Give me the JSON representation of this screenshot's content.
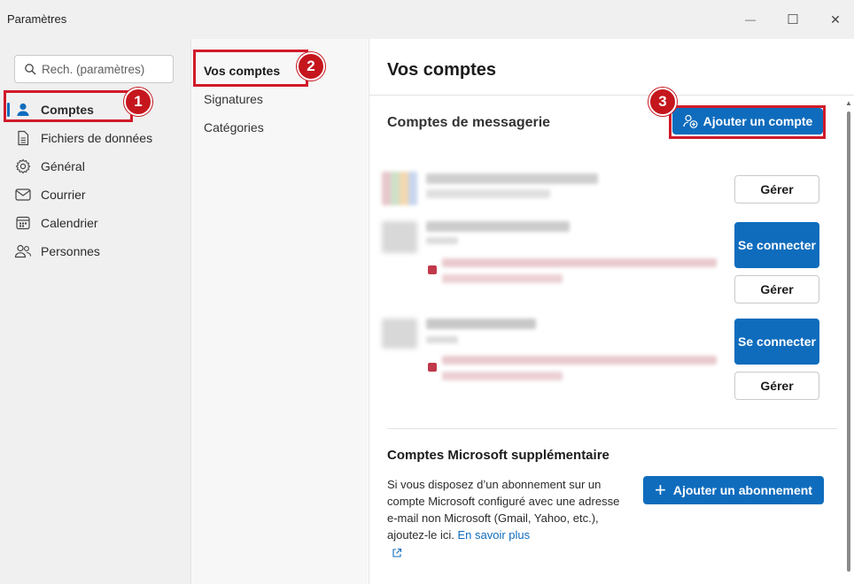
{
  "window": {
    "title": "Paramètres",
    "controls": {
      "minimize": "—",
      "maximize": "☐",
      "close": "✕"
    }
  },
  "nav": {
    "search_placeholder": "Rech. (paramètres)",
    "items": [
      {
        "label": "Comptes",
        "icon": "person-icon",
        "active": true
      },
      {
        "label": "Fichiers de données",
        "icon": "document-icon",
        "active": false
      },
      {
        "label": "Général",
        "icon": "gear-icon",
        "active": false
      },
      {
        "label": "Courrier",
        "icon": "mail-icon",
        "active": false
      },
      {
        "label": "Calendrier",
        "icon": "calendar-icon",
        "active": false
      },
      {
        "label": "Personnes",
        "icon": "people-icon",
        "active": false
      }
    ]
  },
  "subnav": {
    "items": [
      {
        "label": "Vos comptes",
        "active": true
      },
      {
        "label": "Signatures",
        "active": false
      },
      {
        "label": "Catégories",
        "active": false
      }
    ]
  },
  "main": {
    "title": "Vos comptes",
    "email_section_title": "Comptes de messagerie",
    "add_account_label": "Ajouter un compte",
    "accounts": [
      {
        "manage_label": "Gérer"
      },
      {
        "connect_label": "Se connecter",
        "manage_label": "Gérer"
      },
      {
        "connect_label": "Se connecter",
        "manage_label": "Gérer"
      }
    ],
    "ms_section_title": "Comptes Microsoft supplémentaire",
    "ms_text": "Si vous disposez d’un abonnement sur un compte Microsoft configuré avec une adresse e-mail non Microsoft (Gmail, Yahoo, etc.), ajoutez-le ici.",
    "ms_link": "En savoir plus",
    "add_subscription_label": "Ajouter un abonnement"
  },
  "callouts": [
    "1",
    "2",
    "3"
  ],
  "colors": {
    "accent": "#0f6cbd",
    "callout": "#c5161d"
  }
}
